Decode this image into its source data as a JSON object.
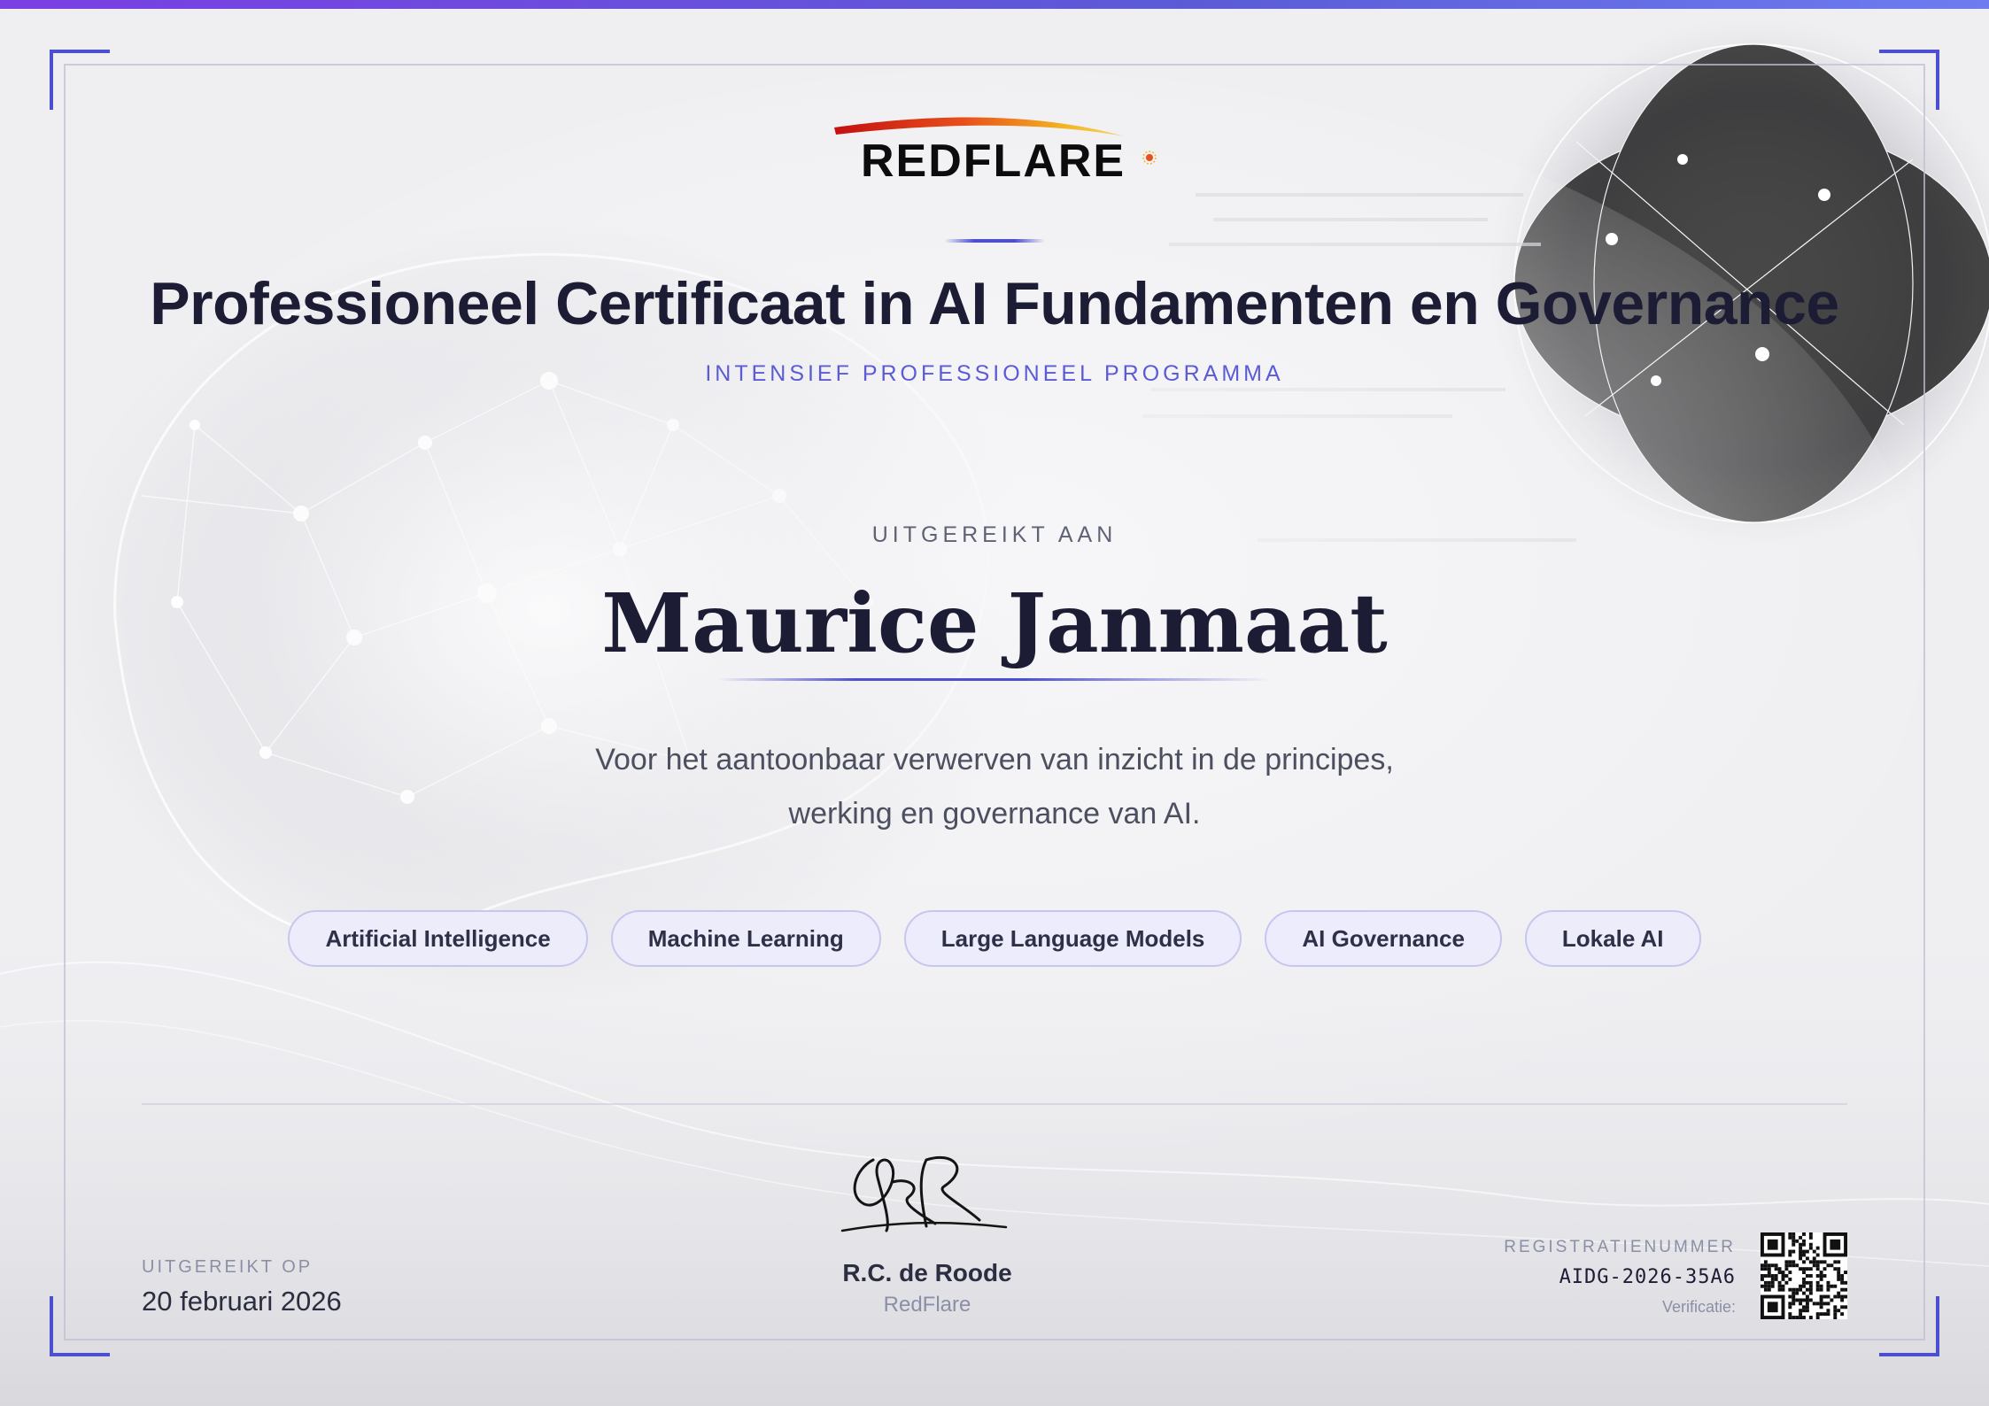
{
  "logo": {
    "text": "REDFLARE"
  },
  "certificate": {
    "title": "Professioneel Certificaat in AI Fundamenten en Governance",
    "subtitle": "INTENSIEF PROFESSIONEEL PROGRAMMA",
    "issued_to_label": "UITGEREIKT AAN",
    "recipient": "Maurice Janmaat",
    "description_line1": "Voor het aantoonbaar verwerven van inzicht in de principes,",
    "description_line2": "werking en governance van AI.",
    "topics": [
      "Artificial Intelligence",
      "Machine Learning",
      "Large Language Models",
      "AI Governance",
      "Lokale AI"
    ]
  },
  "footer": {
    "issued_on_label": "UITGEREIKT OP",
    "issued_on_date": "20 februari 2026",
    "signature_initials": "RR",
    "signer_name": "R.C. de Roode",
    "signer_org": "RedFlare",
    "registration_label": "REGISTRATIENUMMER",
    "registration_number": "AIDG-2026-35A6",
    "verification_label": "Verificatie:"
  },
  "colors": {
    "accent": "#4c4fcf",
    "accent_light": "#5b5bd6",
    "title": "#1c1d35",
    "tag_bg": "#ecebfc",
    "tag_border": "#c7c6ee"
  },
  "icons": [
    "neural-brain-illustration",
    "network-globe-illustration",
    "qr-code"
  ]
}
